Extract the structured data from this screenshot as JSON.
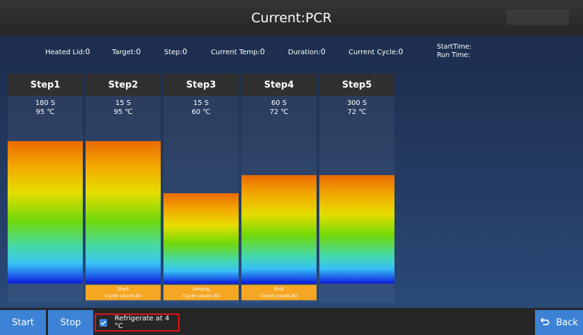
{
  "header": {
    "title": "Current:PCR"
  },
  "status": {
    "heated_lid_label": "Heated Lid:",
    "heated_lid_value": "0",
    "target_label": "Target:",
    "target_value": "0",
    "step_label": "Step:",
    "step_value": "0",
    "current_temp_label": "Current Temp:",
    "current_temp_value": "0",
    "duration_label": "Duration:",
    "duration_value": "0",
    "current_cycle_label": "Current Cycle:",
    "current_cycle_value": "0",
    "start_time_label": "StartTime:",
    "run_time_label": "Run Time:"
  },
  "steps": [
    {
      "name": "Step1",
      "time": "180 S",
      "temp": "95 ℃",
      "level_celsius": 95,
      "cycle_tag_title": "",
      "cycle_tag_count": ""
    },
    {
      "name": "Step2",
      "time": "15 S",
      "temp": "95 ℃",
      "level_celsius": 95,
      "cycle_tag_title": "Start",
      "cycle_tag_count": "Cycle count:30"
    },
    {
      "name": "Step3",
      "time": "15 S",
      "temp": "60 ℃",
      "level_celsius": 60,
      "cycle_tag_title": "Among",
      "cycle_tag_count": "Cycle count:30"
    },
    {
      "name": "Step4",
      "time": "60 S",
      "temp": "72 ℃",
      "level_celsius": 72,
      "cycle_tag_title": "End",
      "cycle_tag_count": "Cycle count:30"
    },
    {
      "name": "Step5",
      "time": "300 S",
      "temp": "72 ℃",
      "level_celsius": 72,
      "cycle_tag_title": "",
      "cycle_tag_count": ""
    }
  ],
  "footer": {
    "start_label": "Start",
    "stop_label": "Stop",
    "refrigerate_label": "Refrigerate at 4 °C",
    "refrigerate_checked": true,
    "back_label": "Back",
    "back_icon": "undo-arrow-icon"
  },
  "colors": {
    "accent_blue": "#3d82d4",
    "cycle_tag_orange": "#f5a623",
    "highlight_red": "#e01414"
  }
}
